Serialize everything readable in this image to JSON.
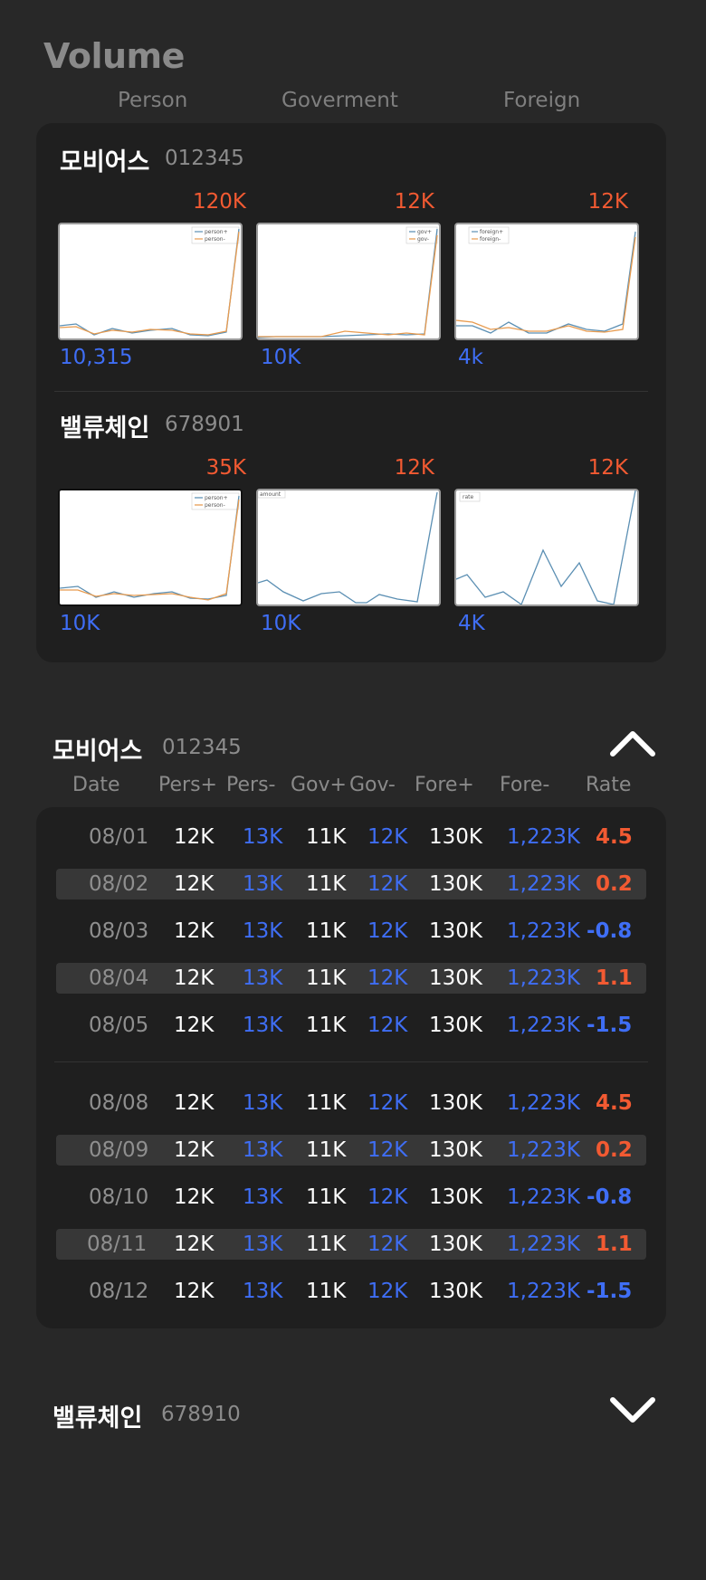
{
  "page": {
    "title": "Volume"
  },
  "columns": [
    "Person",
    "Goverment",
    "Foreign"
  ],
  "summary": [
    {
      "name": "모비어스",
      "code": "012345",
      "charts": [
        {
          "max": "120K",
          "min": "10,315",
          "legend": [
            "person+",
            "person-"
          ]
        },
        {
          "max": "12K",
          "min": "10K",
          "legend": [
            "gov+",
            "gov-"
          ]
        },
        {
          "max": "12K",
          "min": "4k",
          "legend": [
            "foreign+",
            "foreign-"
          ]
        }
      ]
    },
    {
      "name": "밸류체인",
      "code": "678901",
      "charts": [
        {
          "max": "35K",
          "min": "10K",
          "legend": [
            "person+",
            "person-"
          ]
        },
        {
          "max": "12K",
          "min": "10K",
          "legend": [
            "amount"
          ]
        },
        {
          "max": "12K",
          "min": "4K",
          "legend": [
            "rate"
          ]
        }
      ]
    }
  ],
  "detail": {
    "name": "모비어스",
    "code": "012345",
    "expanded": true,
    "headers": [
      "Date",
      "Pers+",
      "Pers-",
      "Gov+",
      "Gov-",
      "Fore+",
      "Fore-",
      "Rate"
    ],
    "groups": [
      [
        {
          "date": "08/01",
          "pers_plus": "12K",
          "pers_minus": "13K",
          "gov_plus": "11K",
          "gov_minus": "12K",
          "fore_plus": "130K",
          "fore_minus": "1,223K",
          "rate": "4.5",
          "dir": "up"
        },
        {
          "date": "08/02",
          "pers_plus": "12K",
          "pers_minus": "13K",
          "gov_plus": "11K",
          "gov_minus": "12K",
          "fore_plus": "130K",
          "fore_minus": "1,223K",
          "rate": "0.2",
          "dir": "up"
        },
        {
          "date": "08/03",
          "pers_plus": "12K",
          "pers_minus": "13K",
          "gov_plus": "11K",
          "gov_minus": "12K",
          "fore_plus": "130K",
          "fore_minus": "1,223K",
          "rate": "-0.8",
          "dir": "down"
        },
        {
          "date": "08/04",
          "pers_plus": "12K",
          "pers_minus": "13K",
          "gov_plus": "11K",
          "gov_minus": "12K",
          "fore_plus": "130K",
          "fore_minus": "1,223K",
          "rate": "1.1",
          "dir": "up"
        },
        {
          "date": "08/05",
          "pers_plus": "12K",
          "pers_minus": "13K",
          "gov_plus": "11K",
          "gov_minus": "12K",
          "fore_plus": "130K",
          "fore_minus": "1,223K",
          "rate": "-1.5",
          "dir": "down"
        }
      ],
      [
        {
          "date": "08/08",
          "pers_plus": "12K",
          "pers_minus": "13K",
          "gov_plus": "11K",
          "gov_minus": "12K",
          "fore_plus": "130K",
          "fore_minus": "1,223K",
          "rate": "4.5",
          "dir": "up"
        },
        {
          "date": "08/09",
          "pers_plus": "12K",
          "pers_minus": "13K",
          "gov_plus": "11K",
          "gov_minus": "12K",
          "fore_plus": "130K",
          "fore_minus": "1,223K",
          "rate": "0.2",
          "dir": "up"
        },
        {
          "date": "08/10",
          "pers_plus": "12K",
          "pers_minus": "13K",
          "gov_plus": "11K",
          "gov_minus": "12K",
          "fore_plus": "130K",
          "fore_minus": "1,223K",
          "rate": "-0.8",
          "dir": "down"
        },
        {
          "date": "08/11",
          "pers_plus": "12K",
          "pers_minus": "13K",
          "gov_plus": "11K",
          "gov_minus": "12K",
          "fore_plus": "130K",
          "fore_minus": "1,223K",
          "rate": "1.1",
          "dir": "up"
        },
        {
          "date": "08/12",
          "pers_plus": "12K",
          "pers_minus": "13K",
          "gov_plus": "11K",
          "gov_minus": "12K",
          "fore_plus": "130K",
          "fore_minus": "1,223K",
          "rate": "-1.5",
          "dir": "down"
        }
      ]
    ]
  },
  "collapsed_section": {
    "name": "밸류체인",
    "code": "678910",
    "expanded": false
  },
  "colors": {
    "up": "#f25a32",
    "down": "#3f6ef5",
    "background": "#282828",
    "card": "#1f1f1f"
  },
  "icons": {
    "collapse": "chevron-up-icon",
    "expand": "chevron-down-icon"
  }
}
